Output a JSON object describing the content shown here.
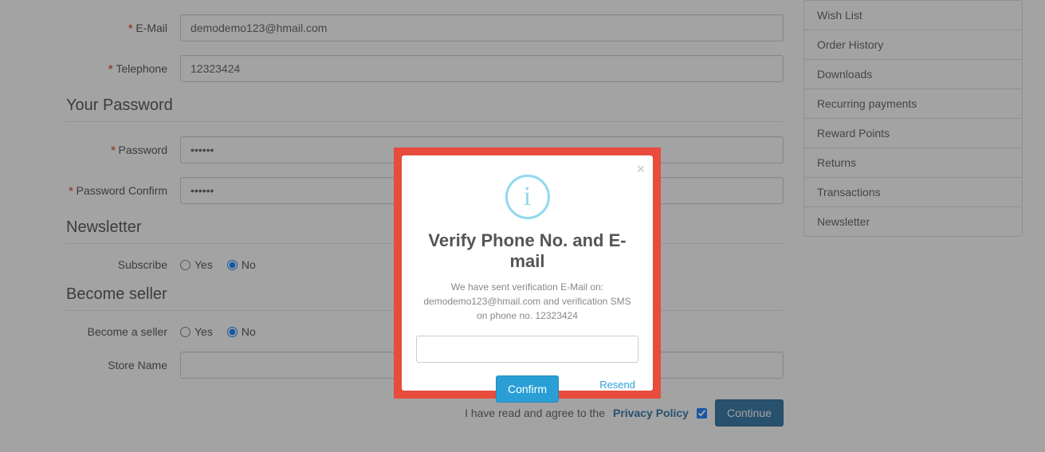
{
  "form": {
    "email_label": "E-Mail",
    "email_value": "demodemo123@hmail.com",
    "telephone_label": "Telephone",
    "telephone_value": "12323424",
    "password_section": "Your Password",
    "password_label": "Password",
    "password_value": "••••••",
    "password_confirm_label": "Password Confirm",
    "password_confirm_value": "••••••",
    "newsletter_section": "Newsletter",
    "subscribe_label": "Subscribe",
    "yes_label": "Yes",
    "no_label": "No",
    "seller_section": "Become seller",
    "seller_label": "Become a seller",
    "store_name_label": "Store Name",
    "store_name_value": "",
    "agree_prefix": "I have read and agree to the ",
    "privacy_policy": "Privacy Policy",
    "continue_label": "Continue"
  },
  "sidebar": {
    "items": [
      {
        "label": "Wish List"
      },
      {
        "label": "Order History"
      },
      {
        "label": "Downloads"
      },
      {
        "label": "Recurring payments"
      },
      {
        "label": "Reward Points"
      },
      {
        "label": "Returns"
      },
      {
        "label": "Transactions"
      },
      {
        "label": "Newsletter"
      }
    ]
  },
  "modal": {
    "title": "Verify Phone No. and E-mail",
    "text": "We have sent verification E-Mail on: demodemo123@hmail.com and verification SMS on phone no. 12323424",
    "confirm_label": "Confirm",
    "resend_label": "Resend",
    "input_value": ""
  }
}
